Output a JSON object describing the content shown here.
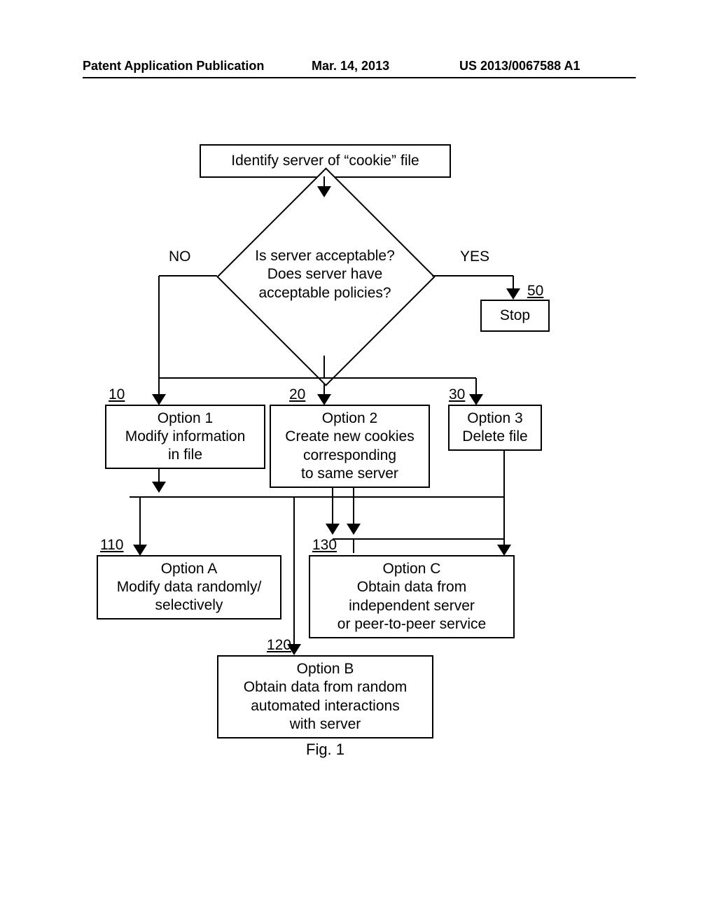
{
  "header": {
    "left": "Patent Application Publication",
    "center": "Mar. 14, 2013",
    "right": "US 2013/0067588 A1"
  },
  "boxes": {
    "start": "Identify server of “cookie” file",
    "stop": "Stop",
    "opt1": "Option 1\nModify information\nin file",
    "opt2": "Option 2\nCreate new cookies\ncorresponding\nto same server",
    "opt3": "Option 3\nDelete file",
    "optA": "Option A\nModify data randomly/\nselectively",
    "optB": "Option B\nObtain data from random\nautomated interactions\nwith server",
    "optC": "Option C\nObtain data from\nindependent server\nor peer-to-peer service"
  },
  "decision": "Is server acceptable?\nDoes server have\nacceptable policies?",
  "labels": {
    "no": "NO",
    "yes": "YES"
  },
  "refs": {
    "r10": "10",
    "r20": "20",
    "r30": "30",
    "r50": "50",
    "r110": "110",
    "r120": "120",
    "r130": "130"
  },
  "caption": "Fig. 1"
}
